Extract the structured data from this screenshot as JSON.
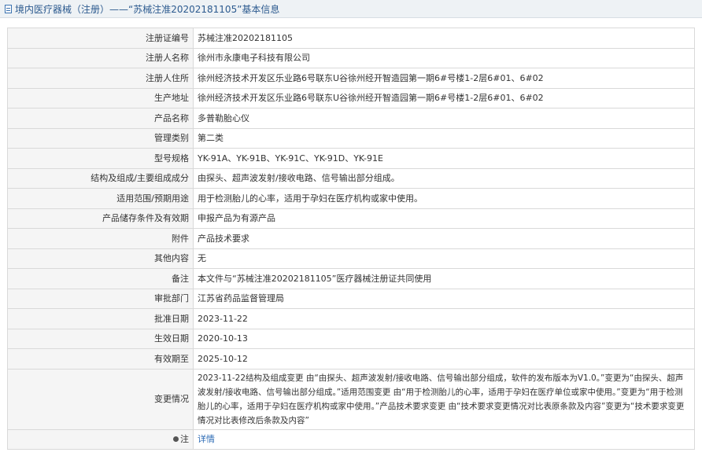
{
  "header": {
    "title": "境内医疗器械（注册）——“苏械注准20202181105”基本信息",
    "icon": "document-icon"
  },
  "rows": [
    {
      "label": "注册证编号",
      "value": "苏械注准20202181105"
    },
    {
      "label": "注册人名称",
      "value": "徐州市永康电子科技有限公司"
    },
    {
      "label": "注册人住所",
      "value": "徐州经济技术开发区乐业路6号联东U谷徐州经开智造园第一期6#号楼1-2层6#01、6#02"
    },
    {
      "label": "生产地址",
      "value": "徐州经济技术开发区乐业路6号联东U谷徐州经开智造园第一期6#号楼1-2层6#01、6#02"
    },
    {
      "label": "产品名称",
      "value": "多普勒胎心仪"
    },
    {
      "label": "管理类别",
      "value": "第二类"
    },
    {
      "label": "型号规格",
      "value": "YK-91A、YK-91B、YK-91C、YK-91D、YK-91E"
    },
    {
      "label": "结构及组成/主要组成成分",
      "value": "由探头、超声波发射/接收电路、信号输出部分组成。"
    },
    {
      "label": "适用范围/预期用途",
      "value": "用于检测胎儿的心率，适用于孕妇在医疗机构或家中使用。"
    },
    {
      "label": "产品储存条件及有效期",
      "value": "申报产品为有源产品"
    },
    {
      "label": "附件",
      "value": "产品技术要求"
    },
    {
      "label": "其他内容",
      "value": "无"
    },
    {
      "label": "备注",
      "value": "本文件与“苏械注准20202181105”医疗器械注册证共同使用"
    },
    {
      "label": "审批部门",
      "value": "江苏省药品监督管理局"
    },
    {
      "label": "批准日期",
      "value": "2023-11-22"
    },
    {
      "label": "生效日期",
      "value": "2020-10-13"
    },
    {
      "label": "有效期至",
      "value": "2025-10-12"
    },
    {
      "label": "变更情况",
      "value": "2023-11-22结构及组成变更 由“由探头、超声波发射/接收电路、信号输出部分组成，软件的发布版本为V1.0。”变更为“由探头、超声波发射/接收电路、信号输出部分组成。”适用范围变更 由“用于检测胎儿的心率，适用于孕妇在医疗单位或家中使用。”变更为“用于检测胎儿的心率，适用于孕妇在医疗机构或家中使用。”产品技术要求变更 由“技术要求变更情况对比表原条款及内容”变更为“技术要求变更情况对比表修改后条款及内容”"
    }
  ],
  "note": {
    "label": "注",
    "icon": "pin-icon",
    "link": "详情"
  },
  "colors": {
    "header_bg": "#eef2f5",
    "title_color": "#2c5a8f",
    "label_bg": "#f5f5f5",
    "border": "#d9d9d9",
    "link": "#2c6bb5"
  }
}
